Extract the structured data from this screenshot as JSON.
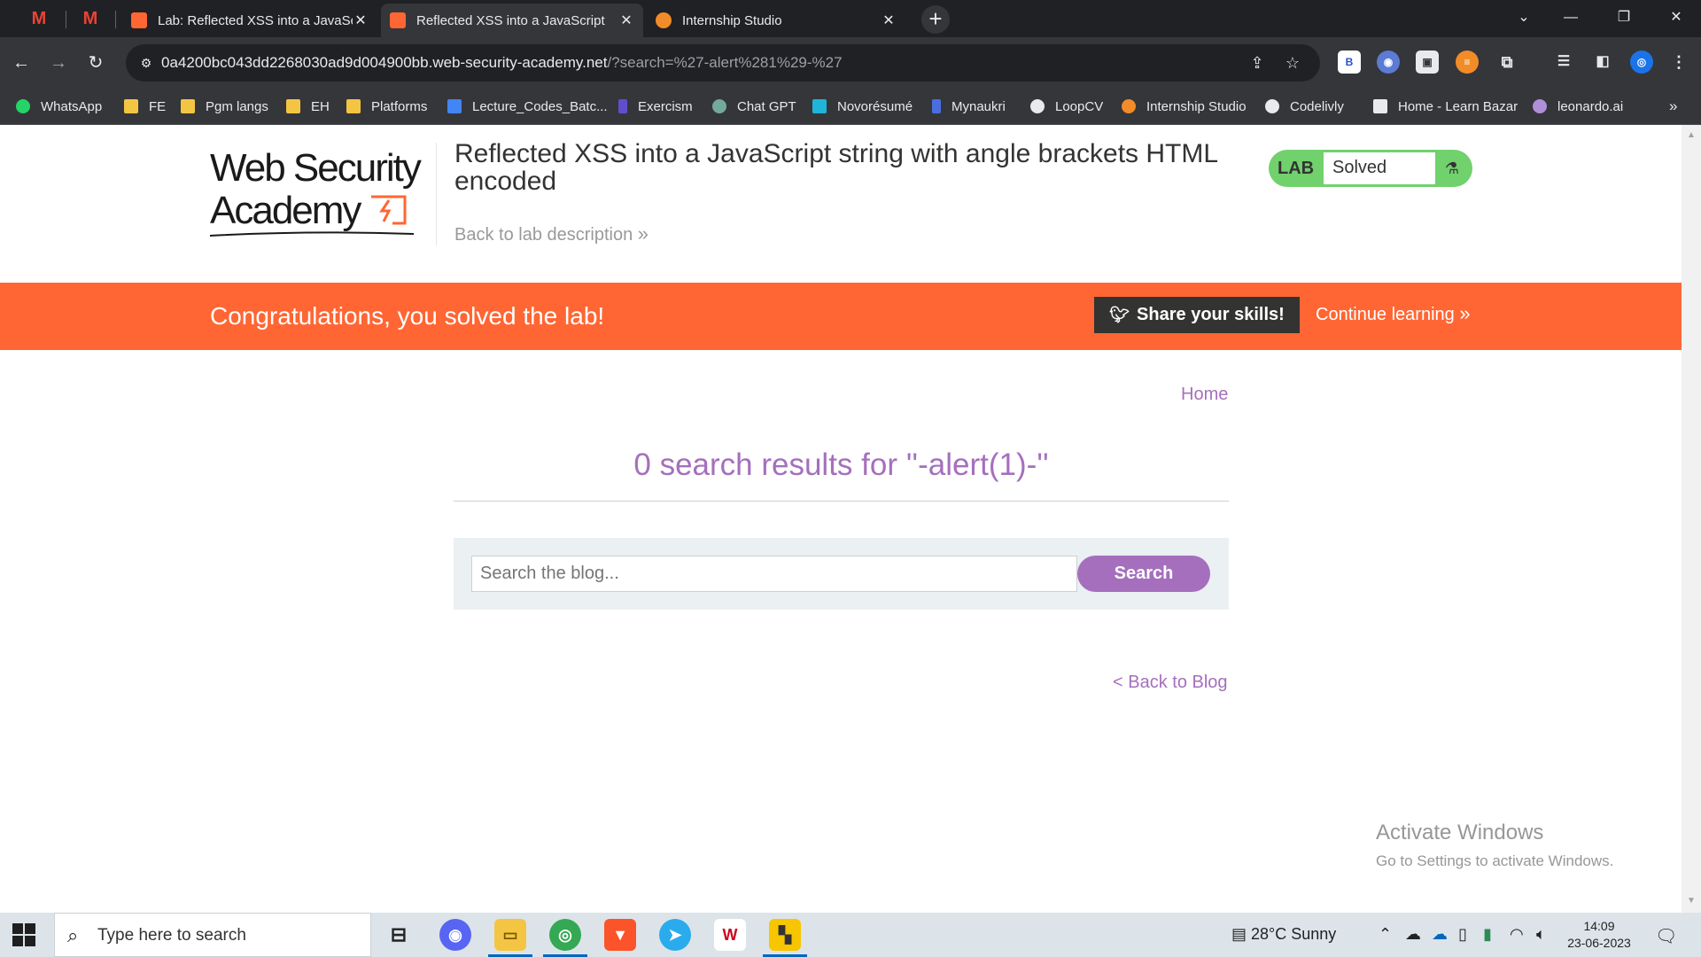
{
  "browser": {
    "tabs": [
      {
        "title": "Lab: Reflected XSS into a JavaSc",
        "active": false,
        "favicon_color": "#ff6633"
      },
      {
        "title": "Reflected XSS into a JavaScript",
        "active": true,
        "favicon_color": "#ff6633"
      },
      {
        "title": "Internship Studio",
        "active": false,
        "favicon_color": "#f28c28"
      }
    ],
    "pinned_tabs": [
      "gmail-icon",
      "gmail-icon"
    ],
    "new_tab_label": "+",
    "url_host": "0a4200bc043dd2268030ad9d004900bb.web-security-academy.net",
    "url_path": "/?search=%27-alert%281%29-%27",
    "bookmarks": [
      {
        "label": "WhatsApp",
        "icon": "whatsapp-icon",
        "color": "#25d366"
      },
      {
        "label": "FE",
        "icon": "folder-icon",
        "color": "#f4c542"
      },
      {
        "label": "Pgm langs",
        "icon": "folder-icon",
        "color": "#f4c542"
      },
      {
        "label": "EH",
        "icon": "folder-icon",
        "color": "#f4c542"
      },
      {
        "label": "Platforms",
        "icon": "folder-icon",
        "color": "#f4c542"
      },
      {
        "label": "Lecture_Codes_Batc...",
        "icon": "doc-icon",
        "color": "#4285f4"
      },
      {
        "label": "Exercism",
        "icon": "exercism-icon",
        "color": "#604fcd"
      },
      {
        "label": "Chat GPT",
        "icon": "chatgpt-icon",
        "color": "#74aa9c"
      },
      {
        "label": "Novorésumé",
        "icon": "novoresume-icon",
        "color": "#1fb4d9"
      },
      {
        "label": "Mynaukri",
        "icon": "mynaukri-icon",
        "color": "#4a6ee0"
      },
      {
        "label": "LoopCV",
        "icon": "loopcv-icon",
        "color": "#e8eaed"
      },
      {
        "label": "Internship Studio",
        "icon": "internship-icon",
        "color": "#f28c28"
      },
      {
        "label": "Codelivly",
        "icon": "codelivly-icon",
        "color": "#e8eaed"
      },
      {
        "label": "Home - Learn Bazar",
        "icon": "learnbazar-icon",
        "color": "#e8eaed"
      },
      {
        "label": "leonardo.ai",
        "icon": "leonardo-icon",
        "color": "#b08fd8"
      }
    ],
    "bookmarks_more": "»"
  },
  "page": {
    "logo_line1": "Web Security",
    "logo_line2": "Academy",
    "lab_title": "Reflected XSS into a JavaScript string with angle brackets HTML encoded",
    "back_to_lab": "Back to lab description",
    "lab_badge": "LAB",
    "lab_status": "Solved",
    "congrats": "Congratulations, you solved the lab!",
    "share_label": "Share your skills!",
    "continue_label": "Continue learning",
    "home_link": "Home",
    "results_title": "0 search results for ''-alert(1)-''",
    "search_placeholder": "Search the blog...",
    "search_button": "Search",
    "back_to_blog": "< Back to Blog",
    "accent_color": "#ff6633",
    "link_color": "#a56fbd",
    "solved_color": "#70d16d"
  },
  "watermark": {
    "line1": "Activate Windows",
    "line2": "Go to Settings to activate Windows."
  },
  "taskbar": {
    "search_placeholder": "Type here to search",
    "weather": "28°C  Sunny",
    "time": "14:09",
    "date": "23-06-2023"
  }
}
